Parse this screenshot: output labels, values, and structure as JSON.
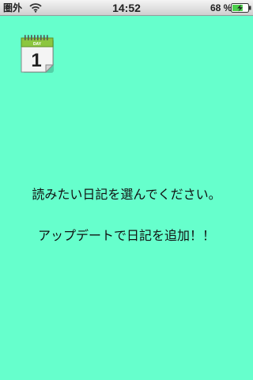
{
  "status_bar": {
    "carrier": "圏外",
    "wifi_icon": "wifi-icon",
    "time": "14:52",
    "battery_percent": "68 %",
    "battery_level": 0.68,
    "battery_icon": "battery-charging-icon"
  },
  "calendar_icon": {
    "icon": "calendar-icon",
    "header_text": "DAY",
    "day_number": "1"
  },
  "main": {
    "message_line1": "読みたい日記を選んでください。",
    "message_line2": "アップデートで日記を追加！！"
  },
  "colors": {
    "background": "#66ffcc",
    "calendar_header": "#8cc63f"
  }
}
